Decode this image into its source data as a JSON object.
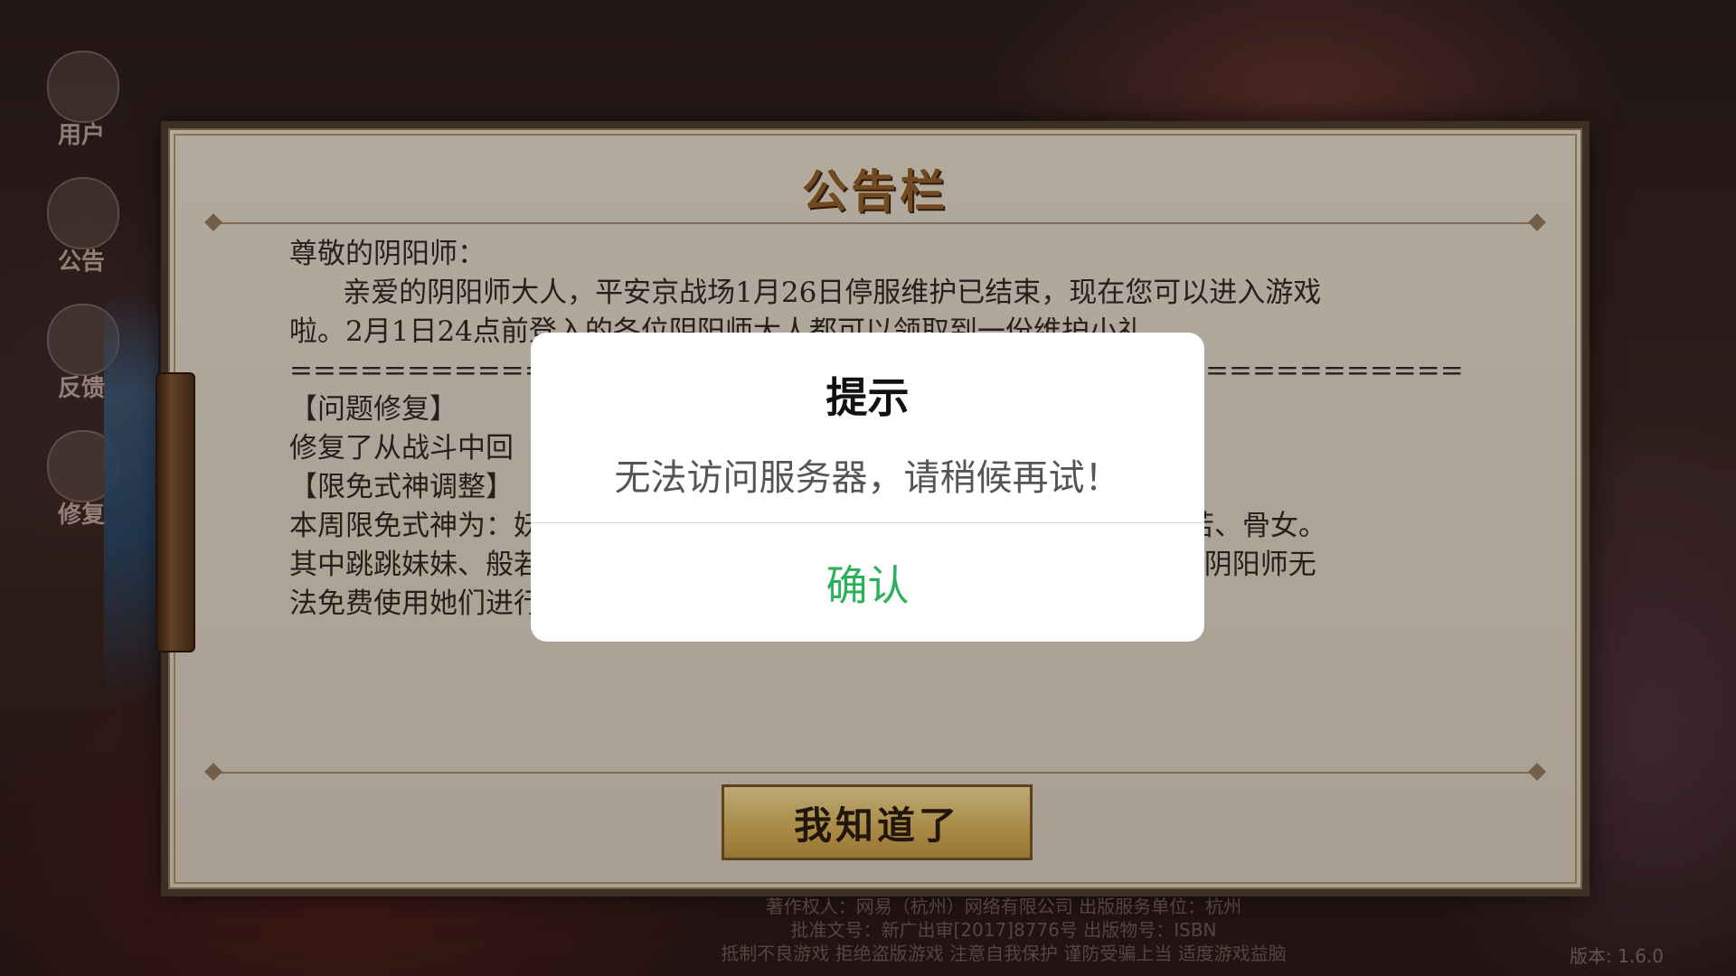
{
  "side_menu": [
    {
      "label": "用户",
      "icon": "user-icon"
    },
    {
      "label": "公告",
      "icon": "notice-icon"
    },
    {
      "label": "反馈",
      "icon": "feedback-icon"
    },
    {
      "label": "修复",
      "icon": "repair-icon"
    }
  ],
  "board": {
    "title": "公告栏",
    "lines": [
      "尊敬的阴阳师：",
      "      亲爱的阴阳师大人，平安京战场1月26日停服维护已结束，现在您可以进入游戏",
      "啦。2月1日24点前登入的各位阴阳师大人都可以领取到一份维护小礼。",
      "",
      "============================================================",
      "",
      "【问题修复】",
      "修复了从战斗中回",
      "",
      "【限免式神调整】",
      "",
      "本周限免式神为：妖狐、吸血姬、判官、辉夜姬、九命猫、跳跳妹妹、般若、骨女。",
      "其中跳跳妹妹、般若、骨女为难度较高的式神，进入平安京时间小于7天的阴阳师无",
      "法免费使用她们进行战斗。"
    ],
    "confirm_button": "我知道了"
  },
  "footer": {
    "line1": "著作权人：网易（杭州）网络有限公司    出版服务单位：杭州",
    "line2": "批准文号：新广出审[2017]8776号    出版物号：ISBN",
    "line3": "抵制不良游戏 拒绝盗版游戏 注意自我保护 谨防受骗上当 适度游戏益脑",
    "version": "版本: 1.6.0"
  },
  "dialog": {
    "title": "提示",
    "message": "无法访问服务器，请稍候再试！",
    "confirm": "确认"
  },
  "colors": {
    "dialog_confirm": "#2bb15b",
    "board_bg": "#d6ccbd",
    "title_gold": "#8a5a2a"
  }
}
